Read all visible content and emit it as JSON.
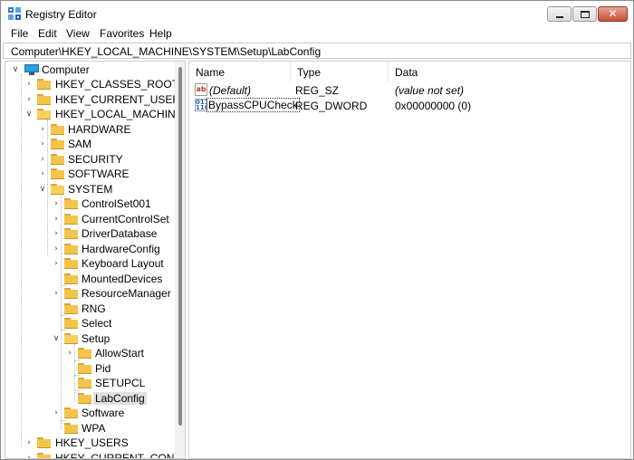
{
  "window": {
    "title": "Registry Editor"
  },
  "menu": [
    "File",
    "Edit",
    "View",
    "Favorites",
    "Help"
  ],
  "address": "Computer\\HKEY_LOCAL_MACHINE\\SYSTEM\\Setup\\LabConfig",
  "tree": {
    "root": "Computer",
    "nodes": [
      {
        "label": "HKEY_CLASSES_ROOT",
        "expander": "collapsed"
      },
      {
        "label": "HKEY_CURRENT_USER",
        "expander": "collapsed"
      },
      {
        "label": "HKEY_LOCAL_MACHINE",
        "expander": "expanded"
      },
      {
        "label": "HARDWARE",
        "expander": "collapsed"
      },
      {
        "label": "SAM",
        "expander": "collapsed"
      },
      {
        "label": "SECURITY",
        "expander": "collapsed"
      },
      {
        "label": "SOFTWARE",
        "expander": "collapsed"
      },
      {
        "label": "SYSTEM",
        "expander": "expanded"
      },
      {
        "label": "ControlSet001",
        "expander": "collapsed"
      },
      {
        "label": "CurrentControlSet",
        "expander": "collapsed"
      },
      {
        "label": "DriverDatabase",
        "expander": "collapsed"
      },
      {
        "label": "HardwareConfig",
        "expander": "collapsed"
      },
      {
        "label": "Keyboard Layout",
        "expander": "collapsed"
      },
      {
        "label": "MountedDevices",
        "expander": "none"
      },
      {
        "label": "ResourceManager",
        "expander": "collapsed"
      },
      {
        "label": "RNG",
        "expander": "none"
      },
      {
        "label": "Select",
        "expander": "none"
      },
      {
        "label": "Setup",
        "expander": "expanded"
      },
      {
        "label": "AllowStart",
        "expander": "collapsed"
      },
      {
        "label": "Pid",
        "expander": "none"
      },
      {
        "label": "SETUPCL",
        "expander": "none"
      },
      {
        "label": "LabConfig",
        "expander": "none",
        "selected": true
      },
      {
        "label": "Software",
        "expander": "collapsed"
      },
      {
        "label": "WPA",
        "expander": "none"
      },
      {
        "label": "HKEY_USERS",
        "expander": "collapsed"
      },
      {
        "label": "HKEY_CURRENT_CONFIG",
        "expander": "collapsed"
      }
    ]
  },
  "list": {
    "columns": [
      "Name",
      "Type",
      "Data"
    ],
    "rows": [
      {
        "name": "(Default)",
        "type": "REG_SZ",
        "data": "(value not set)",
        "icon": "string-value-icon"
      },
      {
        "name": "BypassCPUCheck",
        "type": "REG_DWORD",
        "data": "0x00000000 (0)",
        "icon": "binary-value-icon"
      }
    ]
  },
  "colors": {
    "folder": "#f2c44a",
    "close_button": "#c74d36",
    "computer": "#2a9fdc"
  }
}
